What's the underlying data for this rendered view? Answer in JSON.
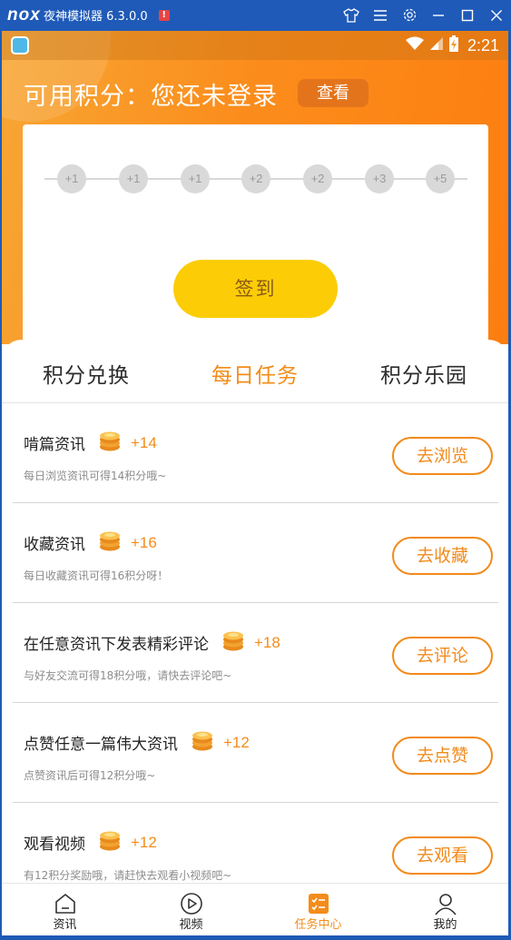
{
  "emulator": {
    "logo": "nox",
    "title": "夜神模拟器 6.3.0.0",
    "alert": "!"
  },
  "status_bar": {
    "time": "2:21"
  },
  "header": {
    "points_title": "可用积分：您还未登录",
    "view_button": "查看"
  },
  "checkin": {
    "days": [
      "+1",
      "+1",
      "+1",
      "+2",
      "+2",
      "+3",
      "+5"
    ],
    "button": "签到"
  },
  "tabs": [
    {
      "label": "积分兑换",
      "active": false
    },
    {
      "label": "每日任务",
      "active": true
    },
    {
      "label": "积分乐园",
      "active": false
    }
  ],
  "tasks": [
    {
      "title": "啃篇资讯",
      "points": "+14",
      "desc": "每日浏览资讯可得14积分哦~",
      "button": "去浏览"
    },
    {
      "title": "收藏资讯",
      "points": "+16",
      "desc": "每日收藏资讯可得16积分呀！",
      "button": "去收藏"
    },
    {
      "title": "在任意资讯下发表精彩评论",
      "points": "+18",
      "desc": "与好友交流可得18积分哦，请快去评论吧~",
      "button": "去评论"
    },
    {
      "title": "点赞任意一篇伟大资讯",
      "points": "+12",
      "desc": "点赞资讯后可得12积分哦~",
      "button": "去点赞"
    },
    {
      "title": "观看视频",
      "points": "+12",
      "desc": "有12积分奖励哦，请赶快去观看小视频吧~",
      "button": "去观看"
    }
  ],
  "bottom_nav": [
    {
      "label": "资讯",
      "icon": "home-icon",
      "active": false
    },
    {
      "label": "视频",
      "icon": "play-icon",
      "active": false
    },
    {
      "label": "任务中心",
      "icon": "task-list-icon",
      "active": true
    },
    {
      "label": "我的",
      "icon": "user-icon",
      "active": false
    }
  ],
  "colors": {
    "accent": "#f38c1a",
    "header_gradient_start": "#f7a634",
    "header_gradient_end": "#fd7e10",
    "signin_button": "#fccd06",
    "emulator_bar": "#1f5ab8"
  }
}
